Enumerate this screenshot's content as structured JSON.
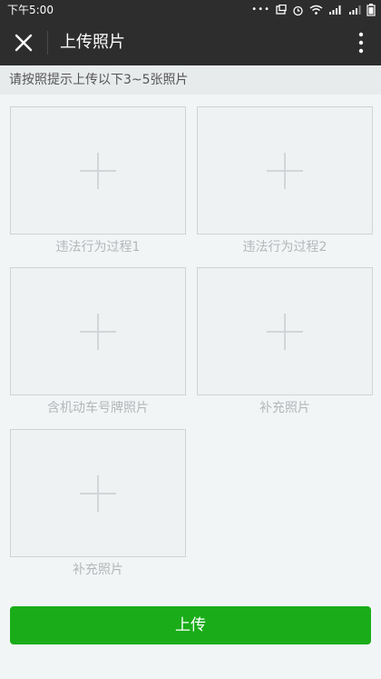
{
  "status_bar": {
    "time": "下午5:00",
    "icons": [
      "dots-icon",
      "screen-icon",
      "alarm-icon",
      "wifi-icon",
      "signal-icon",
      "signal-icon",
      "battery-icon"
    ]
  },
  "header": {
    "title": "上传照片",
    "close_icon": "close-icon",
    "more_icon": "more-vertical-icon"
  },
  "instruction": "请按照提示上传以下3~5张照片",
  "slots": [
    {
      "label": "违法行为过程1"
    },
    {
      "label": "违法行为过程2"
    },
    {
      "label": "含机动车号牌照片"
    },
    {
      "label": "补充照片"
    },
    {
      "label": "补充照片"
    }
  ],
  "upload_button": "上传",
  "colors": {
    "header_bg": "#2d2d2d",
    "button_green": "#1aad19",
    "page_bg": "#f2f5f6"
  }
}
